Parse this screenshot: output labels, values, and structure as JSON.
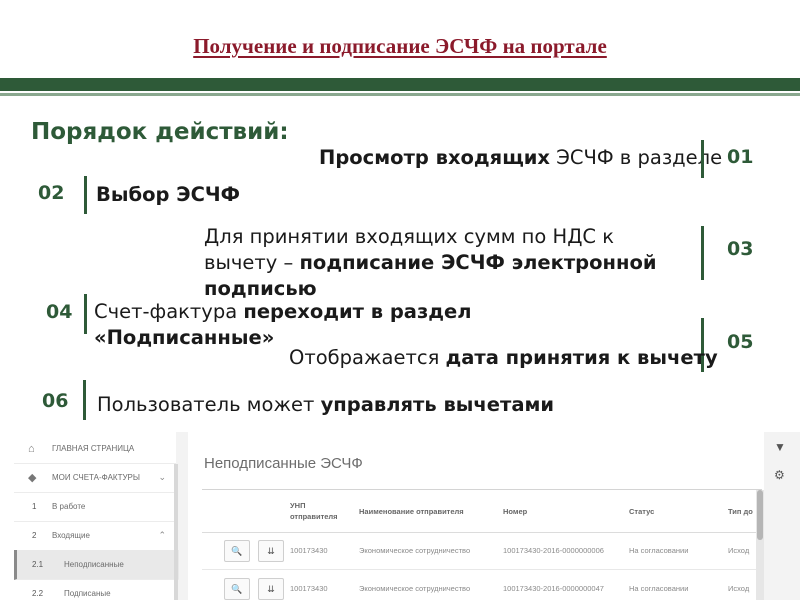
{
  "slide": {
    "title": "Получение и подписание ЭСЧФ на портале",
    "heading": "Порядок действий:"
  },
  "steps": [
    {
      "num": "01",
      "bold": "Просмотр входящих",
      "rest": " ЭСЧФ в разделе"
    },
    {
      "num": "02",
      "bold": "Выбор ЭСЧФ"
    },
    {
      "num": "03",
      "line1": "Для принятии входящих сумм по НДС к",
      "line2_pre": "вычету – ",
      "line2_bold": "подписание ЭСЧФ электронной",
      "line3_bold": "подписью"
    },
    {
      "num": "04",
      "pre": "Счет-фактура ",
      "bold": "переходит в раздел",
      "line2_bold": "«Подписанные»"
    },
    {
      "num": "05",
      "pre": "Отображается ",
      "bold": "дата принятия к вычету"
    },
    {
      "num": "06",
      "pre": "Пользователь может ",
      "bold": "управлять вычетами"
    }
  ],
  "sidebar": {
    "items": [
      {
        "icon": "home-icon",
        "glyph": "⌂",
        "label": "ГЛАВНАЯ СТРАНИЦА"
      },
      {
        "icon": "invoice-icon",
        "glyph": "◆",
        "label": "МОИ СЧЕТА-ФАКТУРЫ",
        "chevron": "⌄"
      },
      {
        "idx": "1",
        "label": "В работе"
      },
      {
        "idx": "2",
        "label": "Входящие",
        "chevron": "⌃"
      },
      {
        "idx": "2.1",
        "label": "Неподписанные"
      },
      {
        "idx": "2.2",
        "label": "Подписаные"
      }
    ]
  },
  "panel": {
    "title": "Неподписанные ЭСЧФ",
    "columns": {
      "unp_line1": "УНП",
      "unp_line2": "отправителя",
      "sender": "Наименование отправителя",
      "number": "Номер",
      "status": "Статус",
      "type": "Тип до"
    },
    "rows": [
      {
        "unp": "100173430",
        "sender": "Экономическое сотрудничество",
        "number": "100173430-2016-0000000006",
        "status": "На согласовании",
        "type": "Исход"
      },
      {
        "unp": "100173430",
        "sender": "Экономическое сотрудничество",
        "number": "100173430-2016-0000000047",
        "status": "На согласовании",
        "type": "Исход"
      }
    ],
    "row_buttons": {
      "view_glyph": "🔍",
      "sign_glyph": "⇊"
    }
  },
  "colors": {
    "accent_green": "#2e5a38",
    "title_red": "#8b1a2b"
  }
}
